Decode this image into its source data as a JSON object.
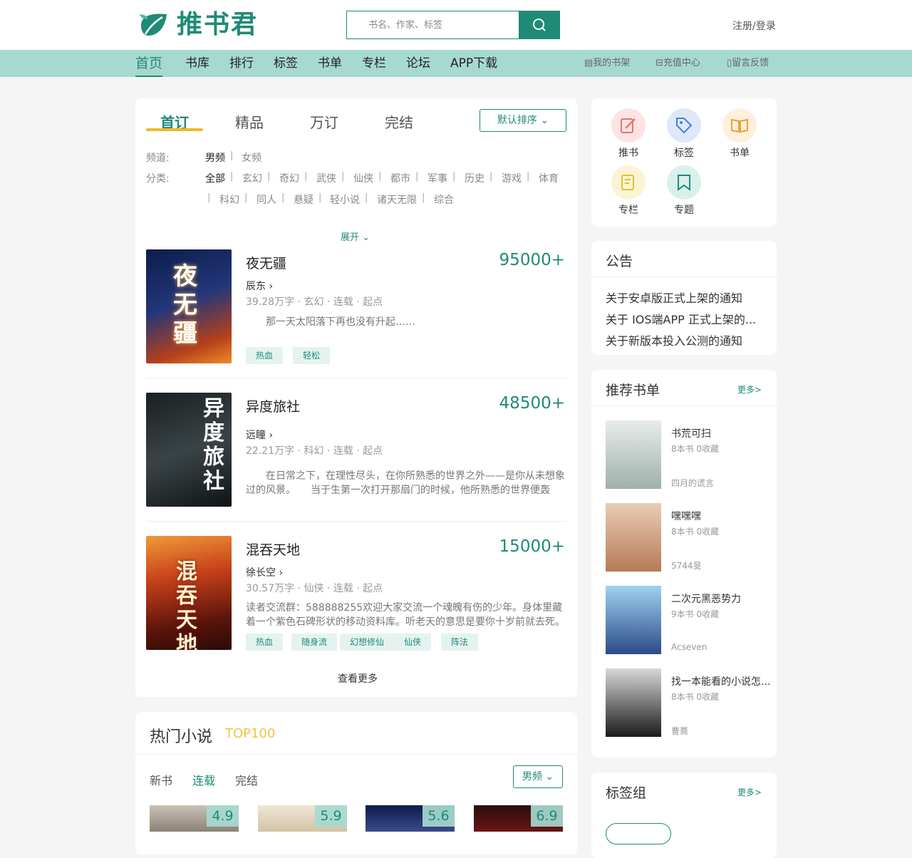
{
  "header": {
    "logo_text": "推书君",
    "search_placeholder": "书名、作家、标签",
    "login": "注册/登录"
  },
  "nav": {
    "items": [
      "首页",
      "书库",
      "排行",
      "标签",
      "书单",
      "专栏",
      "论坛",
      "APP下载"
    ],
    "right": [
      "我的书架",
      "充值中心",
      "留言反馈"
    ]
  },
  "main": {
    "tabs": [
      "首订",
      "精品",
      "万订",
      "完结"
    ],
    "sort": "默认排序",
    "channel_label": "频道:",
    "channels": [
      "男频",
      "女频"
    ],
    "category_label": "分类:",
    "categories": [
      "全部",
      "玄幻",
      "奇幻",
      "武侠",
      "仙侠",
      "都市",
      "军事",
      "历史",
      "游戏",
      "体育",
      "科幻",
      "同人",
      "悬疑",
      "轻小说",
      "诸天无限",
      "综合"
    ],
    "expand": "展开",
    "books": [
      {
        "title": "夜无疆",
        "count": "95000+",
        "author": "辰东",
        "words": "39.28万字",
        "genre": "玄幻",
        "status": "连载",
        "source": "起点",
        "desc": "那一天太阳落下再也没有升起……",
        "tags": [
          "热血",
          "轻松"
        ],
        "cover_text": "夜无疆"
      },
      {
        "title": "异度旅社",
        "count": "48500+",
        "author": "远瞳",
        "words": "22.21万字",
        "genre": "科幻",
        "status": "连载",
        "source": "起点",
        "desc": "在日常之下，在理性尽头，在你所熟悉的世界之外——是你从未想象过的风景。　　当于生第一次打开那扇门的时候，他所熟悉的世界便轰",
        "tags": [],
        "cover_text": "异度旅社"
      },
      {
        "title": "混吞天地",
        "count": "15000+",
        "author": "徐长空",
        "words": "30.57万字",
        "genre": "仙侠",
        "status": "连载",
        "source": "起点",
        "desc": "读者交流群：588888255欢迎大家交流一个魂魄有伤的少年。身体里藏着一个紫色石碑形状的移动资料库。听老天的意思是要你十岁前就去死。",
        "tags": [
          "热血",
          "随身流",
          "幻想修仙",
          "仙侠",
          "阵法"
        ],
        "cover_text": "混吞天地"
      }
    ],
    "more": "查看更多"
  },
  "hot": {
    "title": "热门小说",
    "badge": "TOP100",
    "tabs": [
      "新书",
      "连载",
      "完结"
    ],
    "filter": "男频",
    "scores": [
      "4.9",
      "5.9",
      "5.6",
      "6.9"
    ]
  },
  "quick": {
    "items": [
      "推书",
      "标签",
      "书单",
      "专栏",
      "专题"
    ]
  },
  "notice": {
    "title": "公告",
    "items": [
      "关于安卓版正式上架的通知",
      "关于 IOS端APP 正式上架的...",
      "关于新版本投入公测的通知"
    ]
  },
  "lists": {
    "title": "推荐书单",
    "more": "更多>",
    "items": [
      {
        "title": "书荒可扫",
        "sub": "8本书 0收藏",
        "user": "四月的谎言"
      },
      {
        "title": "嘿嘿嘿",
        "sub": "8本书 0收藏",
        "user": "5744旻"
      },
      {
        "title": "二次元黑恶势力",
        "sub": "9本书 0收藏",
        "user": "Acseven"
      },
      {
        "title": "找一本能看的小说怎...",
        "sub": "8本书 0收藏",
        "user": "曹蕎"
      }
    ]
  },
  "taggroup": {
    "title": "标签组",
    "more": "更多>"
  },
  "colors": {
    "accent": "#1f8a76",
    "nav_bg": "#a6d9d0",
    "tab_underline": "#f0b928"
  }
}
